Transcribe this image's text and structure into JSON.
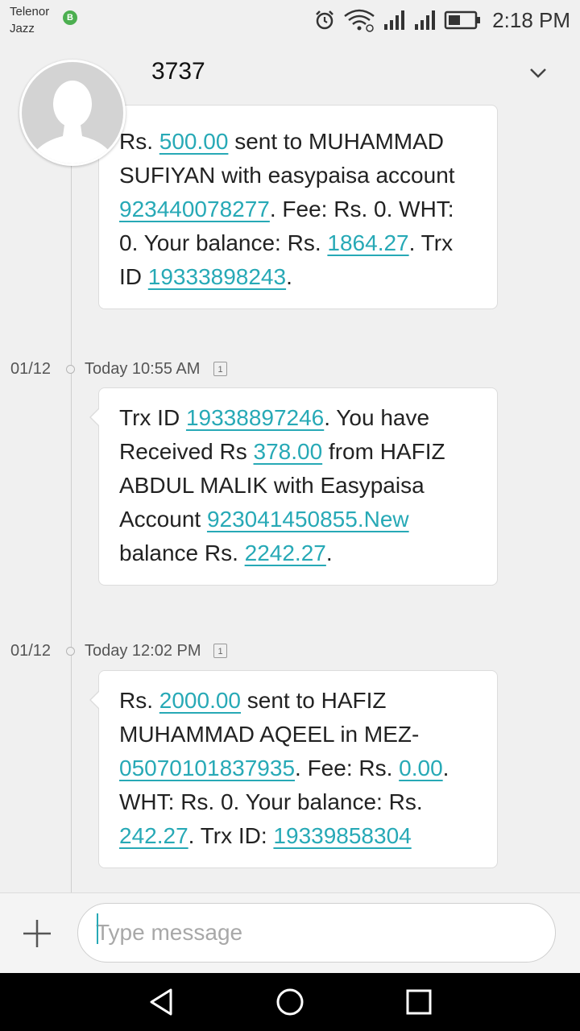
{
  "status_bar": {
    "carrier_line1": "Telenor",
    "carrier_line2": "Jazz",
    "badge": "B",
    "time": "2:18 PM",
    "icons": [
      "alarm-icon",
      "wifi-icon",
      "signal-icon",
      "signal-icon",
      "battery-icon"
    ]
  },
  "header": {
    "title": "3737",
    "expand_icon": "chevron-down-icon"
  },
  "messages": [
    {
      "parts": [
        {
          "t": "Rs. "
        },
        {
          "t": "500.00",
          "link": true
        },
        {
          "t": " sent to MUHAMMAD SUFIYAN with easypaisa account "
        },
        {
          "t": "923440078277",
          "link": true
        },
        {
          "t": ". Fee: Rs. 0. WHT: 0. Your balance: Rs. "
        },
        {
          "t": "1864.27",
          "link": true
        },
        {
          "t": ". Trx ID "
        },
        {
          "t": "19333898243",
          "link": true
        },
        {
          "t": "."
        }
      ]
    },
    {
      "date": "01/12",
      "time": "Today 10:55 AM",
      "sim": "1",
      "parts": [
        {
          "t": "Trx ID "
        },
        {
          "t": "19338897246",
          "link": true
        },
        {
          "t": ". You have Received Rs "
        },
        {
          "t": "378.00",
          "link": true
        },
        {
          "t": " from HAFIZ ABDUL MALIK with Easypaisa Account "
        },
        {
          "t": "923041450855.New",
          "link": true
        },
        {
          "t": " balance Rs. "
        },
        {
          "t": "2242.27",
          "link": true
        },
        {
          "t": "."
        }
      ]
    },
    {
      "date": "01/12",
      "time": "Today 12:02 PM",
      "sim": "1",
      "parts": [
        {
          "t": "Rs. "
        },
        {
          "t": "2000.00",
          "link": true
        },
        {
          "t": " sent to HAFIZ MUHAMMAD AQEEL in MEZ-"
        },
        {
          "t": "05070101837935",
          "link": true
        },
        {
          "t": ". Fee: Rs. "
        },
        {
          "t": "0.00",
          "link": true
        },
        {
          "t": ". WHT: Rs. 0. Your balance: Rs. "
        },
        {
          "t": "242.27",
          "link": true
        },
        {
          "t": ". Trx ID: "
        },
        {
          "t": "19339858304",
          "link": true
        }
      ]
    }
  ],
  "composer": {
    "placeholder": "Type message",
    "attach_icon": "plus-icon"
  },
  "colors": {
    "link": "#27a9b6",
    "background": "#f0f0f0",
    "bubble": "#ffffff",
    "badge": "#4caf50"
  },
  "nav_bar": {
    "icons": [
      "back-triangle-icon",
      "home-circle-icon",
      "recents-square-icon"
    ]
  }
}
